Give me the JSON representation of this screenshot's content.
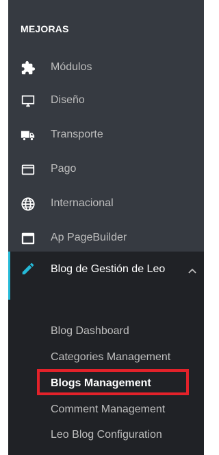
{
  "sidebar": {
    "section_title": "MEJORAS",
    "items": [
      {
        "label": "Módulos",
        "icon": "puzzle-icon"
      },
      {
        "label": "Diseño",
        "icon": "monitor-icon"
      },
      {
        "label": "Transporte",
        "icon": "truck-icon"
      },
      {
        "label": "Pago",
        "icon": "credit-card-icon"
      },
      {
        "label": "Internacional",
        "icon": "globe-icon"
      },
      {
        "label": "Ap PageBuilder",
        "icon": "window-icon"
      }
    ],
    "active": {
      "label": "Blog de Gestión de Leo",
      "icon": "pencil-icon",
      "expanded_icon": "chevron-up-icon",
      "subitems": [
        {
          "label": "Blog Dashboard"
        },
        {
          "label": "Categories Management"
        },
        {
          "label": "Blogs Management",
          "selected": true
        },
        {
          "label": "Comment Management"
        },
        {
          "label": "Leo Blog Configuration"
        }
      ]
    }
  },
  "colors": {
    "sidebar_bg": "#363a41",
    "active_bg": "#202226",
    "accent": "#25b9d7",
    "highlight": "#e3222a"
  }
}
